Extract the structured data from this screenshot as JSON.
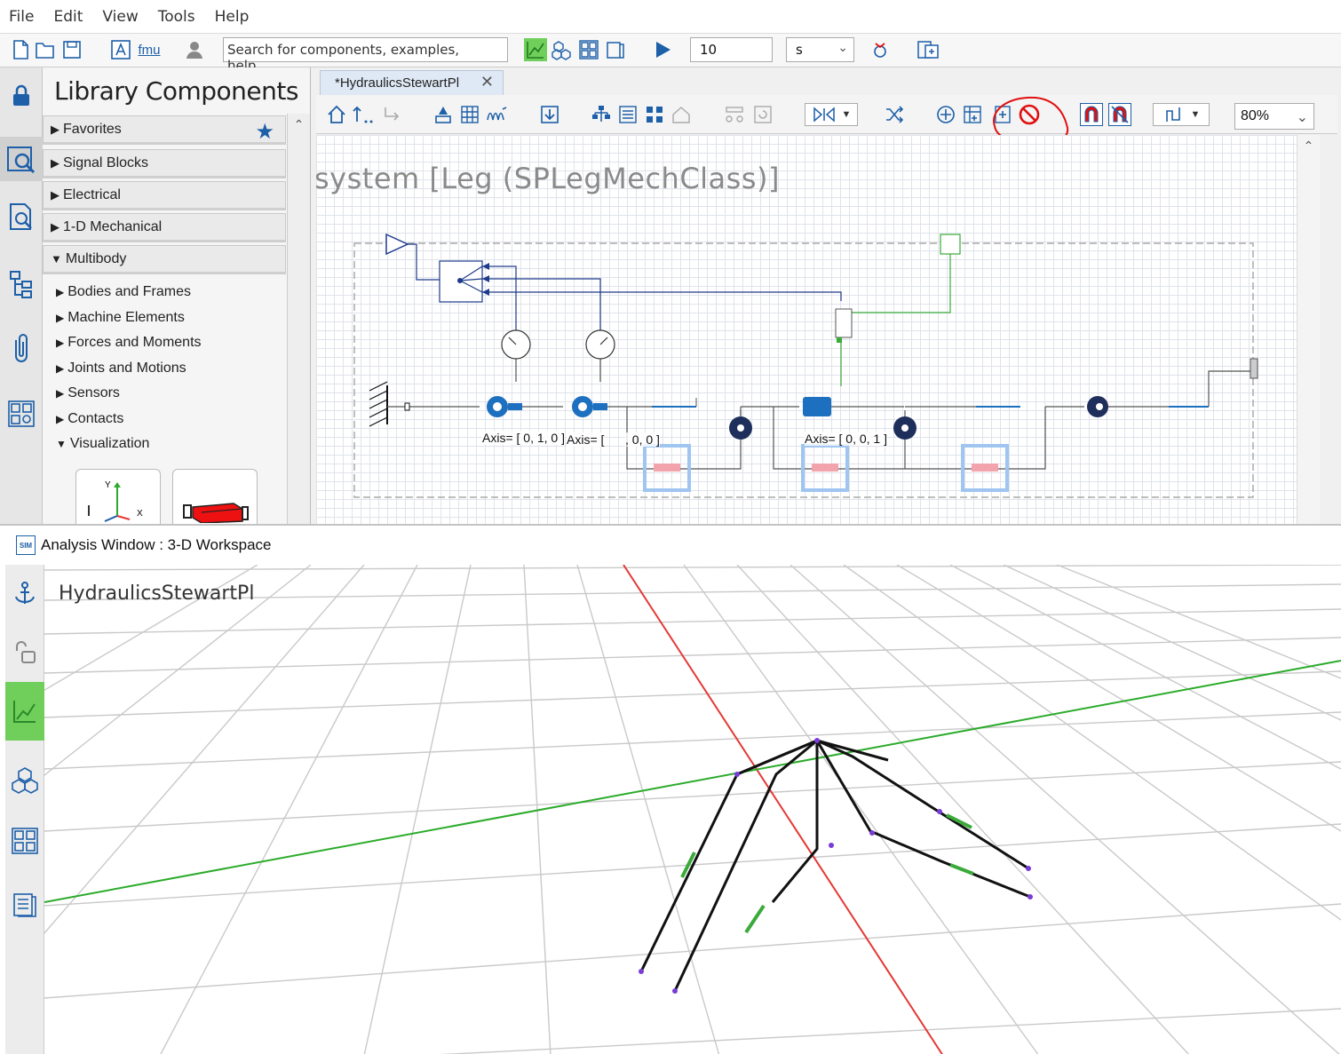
{
  "menu": [
    "File",
    "Edit",
    "View",
    "Tools",
    "Help"
  ],
  "toolbar": {
    "fmu_label": "fmu",
    "search_placeholder": "Search for components, examples, help...",
    "sim_time": "10",
    "time_unit": "s"
  },
  "library": {
    "title": "Library Components",
    "categories": [
      "Favorites",
      "Signal Blocks",
      "Electrical",
      "1-D Mechanical",
      "Multibody"
    ],
    "multibody_items": [
      "Bodies and Frames",
      "Machine Elements",
      "Forces and Moments",
      "Joints and Motions",
      "Sensors",
      "Contacts",
      "Visualization"
    ],
    "thumb_axis_y": "Y",
    "thumb_axis_x": "X"
  },
  "editor": {
    "tab_label": "*HydraulicsStewartPl",
    "tab_close": "✕",
    "diagram_title": "system [Leg (SPLegMechClass)]",
    "zoom": "80%",
    "axis_labels": [
      "Axis= [ 0, 1, 0 ]",
      "Axis= [",
      ", 0, 0 ]",
      "Axis= [ 0, 0, 1 ]"
    ]
  },
  "analysis": {
    "window_title": "Analysis Window : 3-D Workspace",
    "sim_badge": "SIM",
    "workspace_label": "HydraulicsStewartPl"
  },
  "colors": {
    "accent_blue": "#1d5fa8",
    "active_green": "#6fcf5a",
    "annotation_red": "#e01010",
    "x_axis": "#e53935",
    "y_axis": "#2bab2b"
  },
  "icons": [
    "new-file-icon",
    "open-folder-icon",
    "save-icon",
    "text-icon",
    "user-icon",
    "plot-icon",
    "3d-view-icon",
    "dashboard-icon",
    "book-icon",
    "play-icon",
    "debug-icon",
    "export-icon",
    "lock-icon",
    "search-library-icon",
    "search-doc-icon",
    "tree-icon",
    "clip-icon",
    "grid-icon",
    "star-icon",
    "home-icon",
    "no-entry-icon",
    "anchor-icon",
    "unlock-icon",
    "chart-icon",
    "cubes-icon",
    "table-icon",
    "notebook-icon"
  ]
}
